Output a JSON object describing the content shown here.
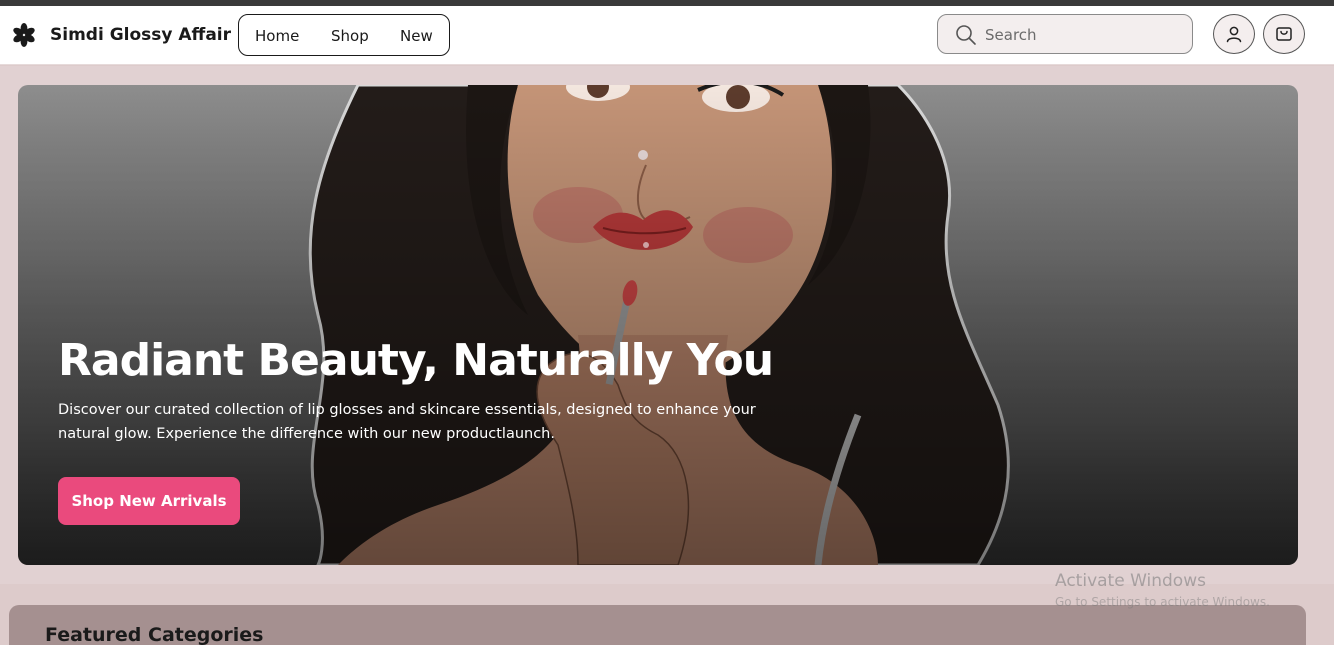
{
  "header": {
    "brand": "Simdi Glossy Affair",
    "nav": [
      {
        "label": "Home"
      },
      {
        "label": "Shop"
      },
      {
        "label": "New"
      }
    ],
    "search": {
      "placeholder": "Search",
      "value": ""
    },
    "icons": [
      "asterisk-logo-icon",
      "search-icon",
      "user-icon",
      "cart-icon"
    ]
  },
  "hero": {
    "title": "Radiant Beauty, Naturally You",
    "description": "Discover our curated collection of lip glosses and skincare essentials, designed to enhance your natural glow. Experience the difference with our new productlaunch.",
    "cta_label": "Shop New Arrivals"
  },
  "featured": {
    "title": "Featured Categories"
  },
  "watermark": {
    "line1": "Activate Windows",
    "line2": "Go to Settings to activate Windows."
  },
  "colors": {
    "accent": "#ea4a7d",
    "page_bg": "#ddcbcb",
    "featured_bg": "#a59090",
    "header_bg": "#ffffff"
  }
}
